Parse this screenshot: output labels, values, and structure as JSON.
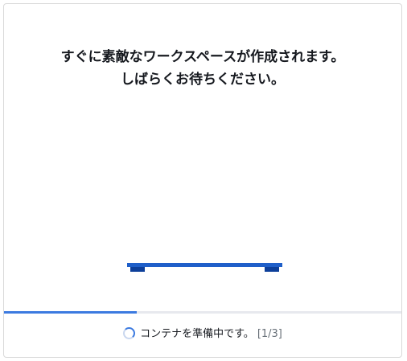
{
  "message": {
    "line1": "すぐに素敵なワークスペースが作成されます。",
    "line2": "しばらくお待ちください。"
  },
  "progress": {
    "fraction": 0.333
  },
  "status": {
    "text": "コンテナを準備中です。",
    "step": "[1/3]",
    "icon": "loading-spinner-icon"
  },
  "colors": {
    "accent": "#3c7ae0",
    "illustration": "#1f5fc9"
  }
}
